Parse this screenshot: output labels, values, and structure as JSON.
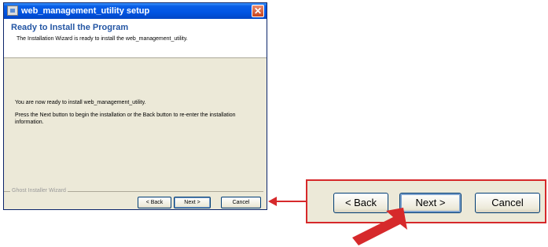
{
  "window": {
    "title": "web_management_utility setup",
    "close_glyph": "✕",
    "header_title": "Ready to Install the Program",
    "header_subtitle": "The Installation Wizard is ready to install the web_management_utility.",
    "body_line1": "You are now ready to install web_management_utility.",
    "body_line2": "Press the Next button to begin the installation or the Back button to re-enter the installation information.",
    "group_label": "Ghost Installer Wizard",
    "back_label": "< Back",
    "next_label": "Next >",
    "cancel_label": "Cancel"
  },
  "zoom": {
    "back_label": "< Back",
    "next_label": "Next >",
    "cancel_label": "Cancel"
  },
  "colors": {
    "accent_red": "#d6292b",
    "titlebar_blue": "#0054e3",
    "header_title_blue": "#2456a4",
    "dialog_bg": "#ece9d8"
  }
}
